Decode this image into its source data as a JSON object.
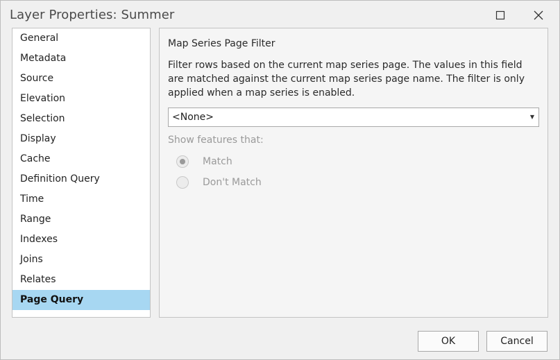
{
  "window": {
    "title": "Layer Properties: Summer"
  },
  "icons": {
    "maximize": "maximize-icon",
    "close": "close-icon",
    "dropdown": "chevron-down-icon"
  },
  "colors": {
    "active_item_bg": "#a7d7f2",
    "disabled_text": "#9a9a9a"
  },
  "sidebar": {
    "items": [
      {
        "label": "General"
      },
      {
        "label": "Metadata"
      },
      {
        "label": "Source"
      },
      {
        "label": "Elevation"
      },
      {
        "label": "Selection"
      },
      {
        "label": "Display"
      },
      {
        "label": "Cache"
      },
      {
        "label": "Definition Query"
      },
      {
        "label": "Time"
      },
      {
        "label": "Range"
      },
      {
        "label": "Indexes"
      },
      {
        "label": "Joins"
      },
      {
        "label": "Relates"
      },
      {
        "label": "Page Query"
      }
    ],
    "active": "Page Query"
  },
  "main": {
    "heading": "Map Series Page Filter",
    "description": "Filter rows based on the current map series page. The values in this field are matched against the current map series page name. The filter is only applied when a map series is enabled.",
    "field_select": {
      "value": "<None>"
    },
    "show_label": "Show features that:",
    "options": [
      {
        "label": "Match",
        "selected": true
      },
      {
        "label": "Don't Match",
        "selected": false
      }
    ]
  },
  "footer": {
    "ok_label": "OK",
    "cancel_label": "Cancel"
  }
}
